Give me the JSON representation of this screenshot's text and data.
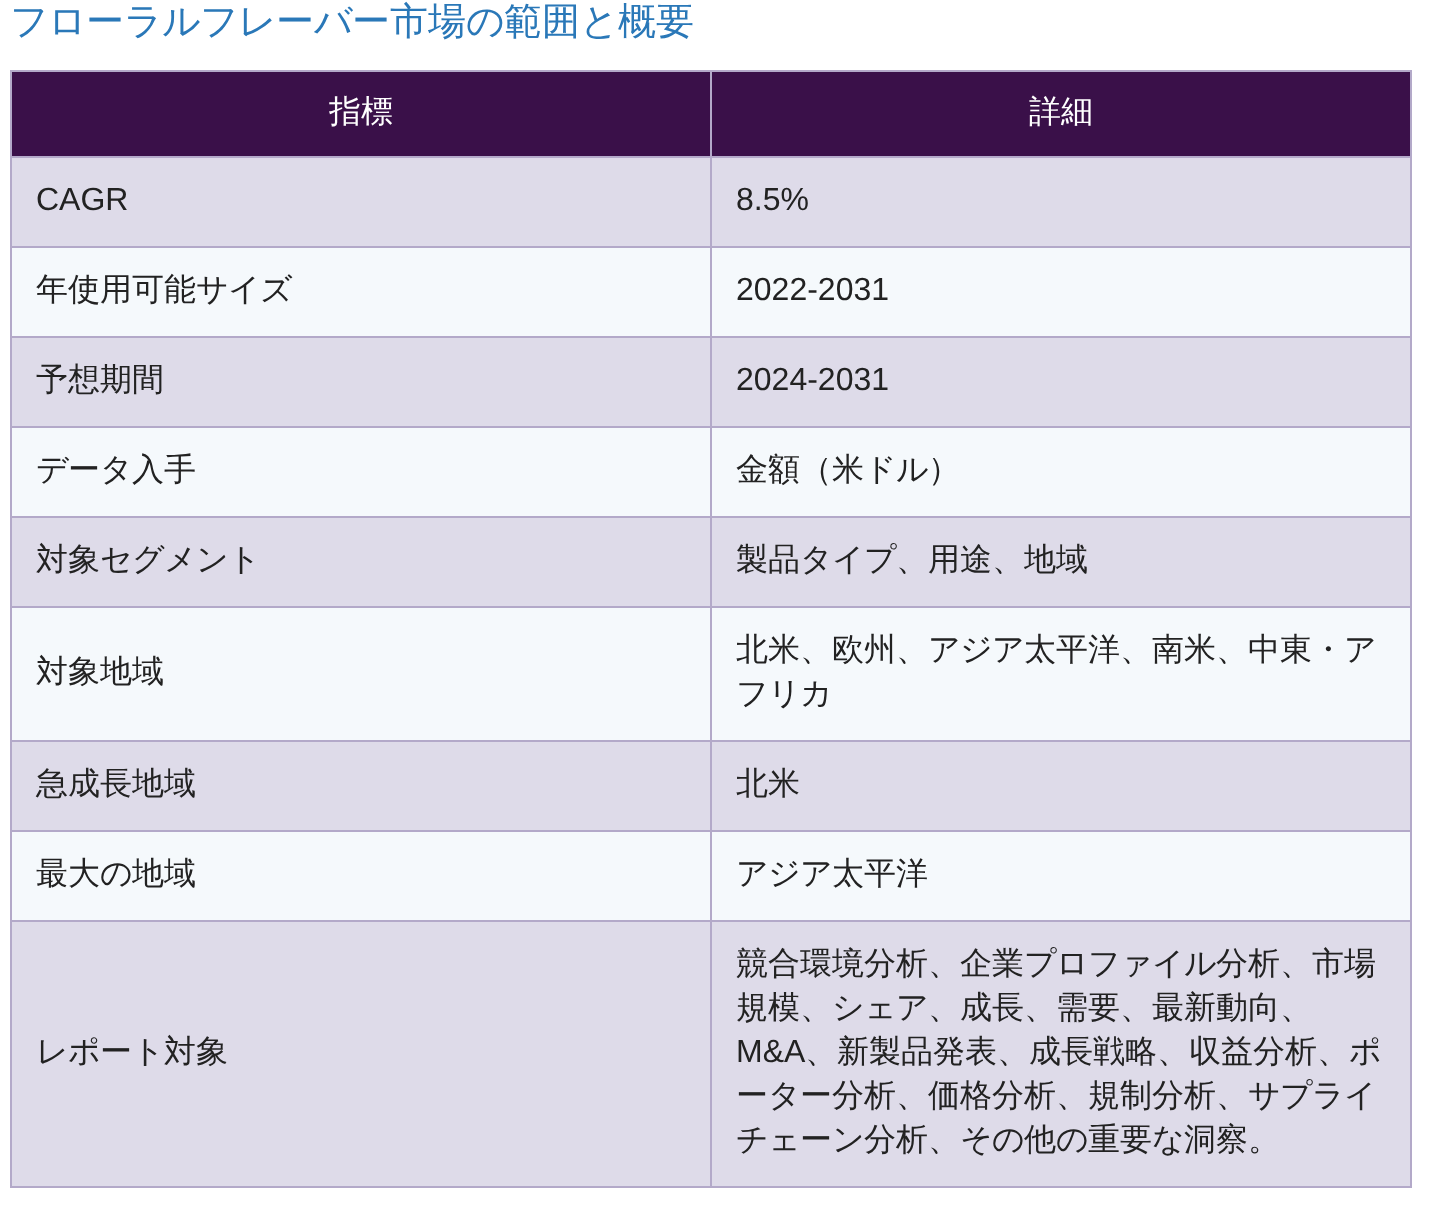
{
  "title": "フローラルフレーバー市場の範囲と概要",
  "table": {
    "columns": [
      "指標",
      "詳細"
    ],
    "rows": [
      [
        "CAGR",
        "8.5%"
      ],
      [
        "年使用可能サイズ",
        "2022-2031"
      ],
      [
        "予想期間",
        "2024-2031"
      ],
      [
        "データ入手",
        "金額（米ドル）"
      ],
      [
        "対象セグメント",
        "製品タイプ、用途、地域"
      ],
      [
        "対象地域",
        "北米、欧州、アジア太平洋、南米、中東・アフリカ"
      ],
      [
        "急成長地域",
        "北米"
      ],
      [
        "最大の地域",
        "アジア太平洋"
      ],
      [
        "レポート対象",
        "競合環境分析、企業プロファイル分析、市場規模、シェア、成長、需要、最新動向、M&A、新製品発表、成長戦略、収益分析、ポーター分析、価格分析、規制分析、サプライチェーン分析、その他の重要な洞察。"
      ]
    ]
  }
}
